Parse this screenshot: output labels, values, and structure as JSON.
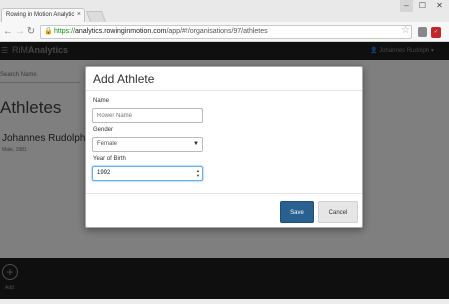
{
  "browser": {
    "tab_title": "Rowing in Motion Analytic",
    "tab_close": "×",
    "url_protocol": "https://",
    "url_host": "analytics.rowinginmotion.com",
    "url_path": "/app/#!/organisations/97/athletes",
    "window_min": "–",
    "window_max": "☐",
    "window_close": "✕"
  },
  "app": {
    "brand_prefix": "RiM",
    "brand_suffix": "Analytics",
    "user_name": "Johannes Rudolph ▾"
  },
  "page": {
    "search_placeholder": "Search Name",
    "title": "Athletes",
    "athlete": {
      "name": "Johannes Rudolph",
      "sub": "Male, 1981"
    },
    "add_label": "Add"
  },
  "modal": {
    "title": "Add Athlete",
    "name_label": "Name",
    "name_placeholder": "Rower Name",
    "gender_label": "Gender",
    "gender_value": "Female",
    "year_label": "Year of Birth",
    "year_value": "1992",
    "save_label": "Save",
    "cancel_label": "Cancel"
  },
  "colors": {
    "primary_button": "#286090",
    "app_header": "#1f1f1f"
  }
}
